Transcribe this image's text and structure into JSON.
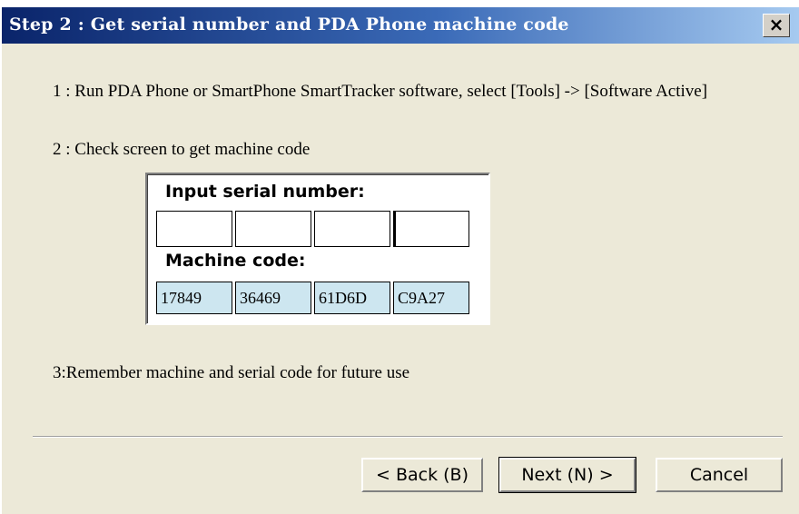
{
  "window": {
    "title": "Step 2 : Get serial number and PDA Phone machine code",
    "close_label": "×"
  },
  "steps": {
    "step1": "1 : Run PDA Phone or SmartPhone SmartTracker software, select [Tools] -> [Software Active]",
    "step2": "2 : Check screen to get machine code",
    "step3": "3:Remember machine and serial code for future use"
  },
  "panel": {
    "serial_label": "Input serial number:",
    "serial_values": [
      "",
      "",
      "",
      ""
    ],
    "machine_label": "Machine code:",
    "machine_codes": [
      "17849",
      "36469",
      "61D6D",
      "C9A27"
    ]
  },
  "buttons": {
    "back": "< Back (B)",
    "next": "Next (N) >",
    "cancel": "Cancel"
  }
}
